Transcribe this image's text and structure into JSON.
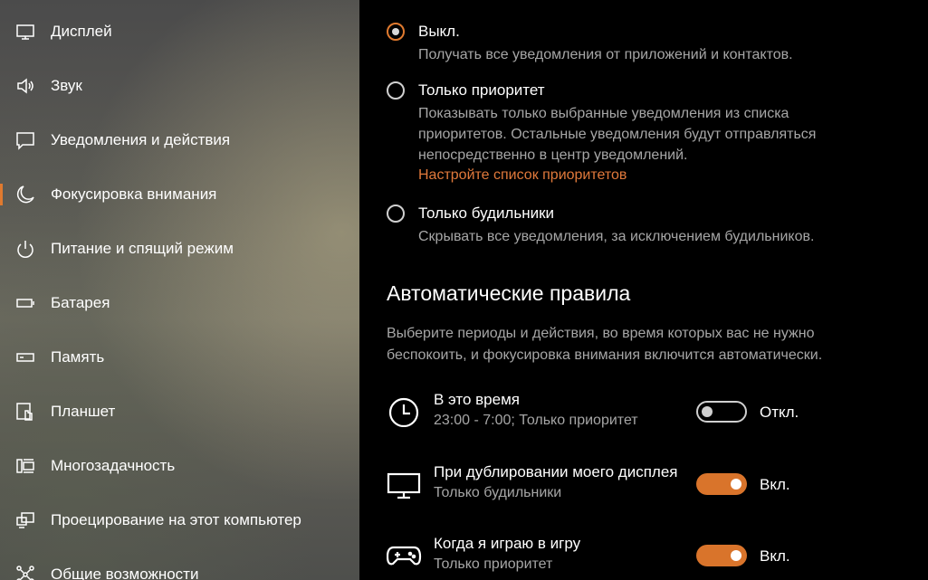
{
  "sidebar": {
    "items": [
      {
        "label": "Дисплей",
        "icon": "monitor-icon"
      },
      {
        "label": "Звук",
        "icon": "speaker-icon"
      },
      {
        "label": "Уведомления и действия",
        "icon": "message-icon"
      },
      {
        "label": "Фокусировка внимания",
        "icon": "moon-icon",
        "active": true
      },
      {
        "label": "Питание и спящий режим",
        "icon": "power-icon"
      },
      {
        "label": "Батарея",
        "icon": "battery-icon"
      },
      {
        "label": "Память",
        "icon": "storage-icon"
      },
      {
        "label": "Планшет",
        "icon": "tablet-icon"
      },
      {
        "label": "Многозадачность",
        "icon": "multitask-icon"
      },
      {
        "label": "Проецирование на этот компьютер",
        "icon": "project-icon"
      },
      {
        "label": "Общие возможности",
        "icon": "shared-icon"
      }
    ]
  },
  "focus_options": [
    {
      "title": "Выкл.",
      "desc": "Получать все уведомления от приложений и контактов.",
      "checked": true
    },
    {
      "title": "Только приоритет",
      "desc": "Показывать только выбранные уведомления из списка приоритетов. Остальные уведомления будут отправляться непосредственно в центр уведомлений.",
      "link": "Настройте список приоритетов",
      "checked": false
    },
    {
      "title": "Только будильники",
      "desc": "Скрывать все уведомления, за исключением будильников.",
      "checked": false
    }
  ],
  "auto_rules": {
    "title": "Автоматические правила",
    "desc": "Выберите периоды и действия, во время которых вас не нужно беспокоить, и фокусировка внимания включится автоматически.",
    "rules": [
      {
        "title": "В это время",
        "subtitle": "23:00 - 7:00; Только приоритет",
        "state": "Откл.",
        "on": false,
        "icon": "clock-icon"
      },
      {
        "title": "При дублировании моего дисплея",
        "subtitle": "Только будильники",
        "state": "Вкл.",
        "on": true,
        "icon": "display-icon"
      },
      {
        "title": "Когда я играю в игру",
        "subtitle": "Только приоритет",
        "state": "Вкл.",
        "on": true,
        "icon": "gamepad-icon"
      }
    ]
  },
  "colors": {
    "accent": "#e07a2f",
    "link": "#e0793b",
    "secondary_text": "#a6a6a6"
  }
}
